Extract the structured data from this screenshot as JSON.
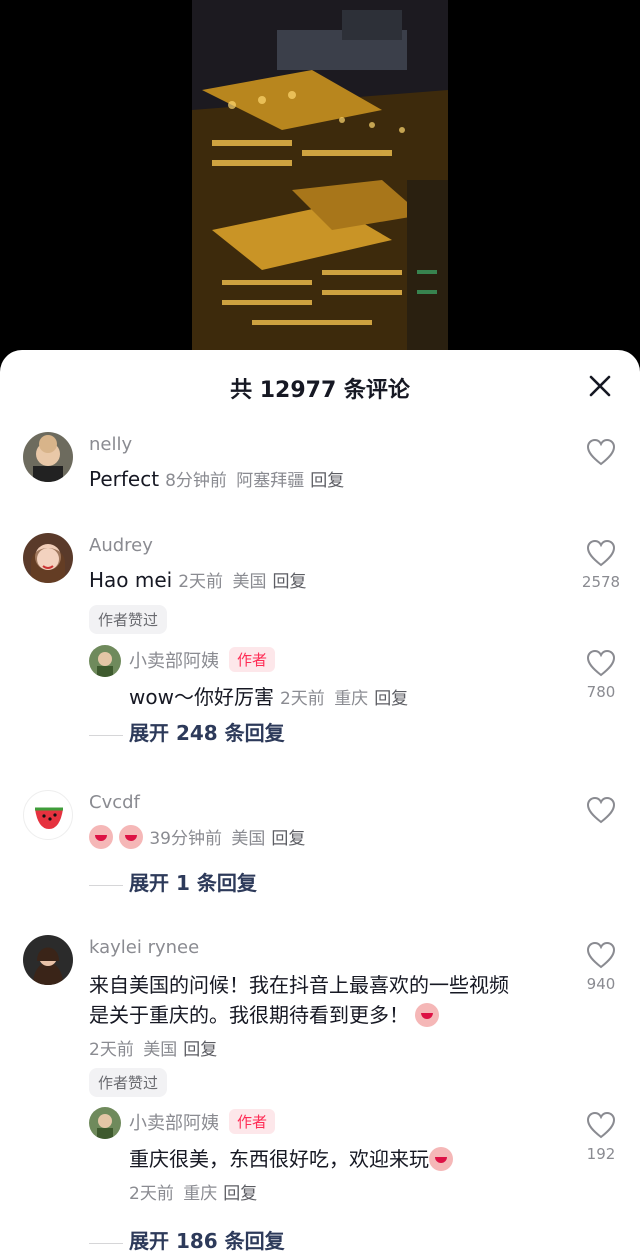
{
  "header": {
    "title": "共 12977 条评论"
  },
  "comments": [
    {
      "username": "nelly",
      "text": "Perfect",
      "time": "8分钟前",
      "location": "阿塞拜疆",
      "reply_label": "回复",
      "likes": ""
    },
    {
      "username": "Audrey",
      "text": "Hao mei",
      "time": "2天前",
      "location": "美国",
      "reply_label": "回复",
      "likes": "2578",
      "badge": "作者赞过",
      "sub": {
        "username": "小卖部阿姨",
        "author_tag": "作者",
        "text": "wow～你好厉害",
        "time": "2天前",
        "location": "重庆",
        "reply_label": "回复",
        "likes": "780"
      },
      "expand": "展开 248 条回复"
    },
    {
      "username": "Cvcdf",
      "text": "",
      "time": "39分钟前",
      "location": "美国",
      "reply_label": "回复",
      "likes": "",
      "expand": "展开 1 条回复"
    },
    {
      "username": "kaylei rynee",
      "text_line1": "来自美国的问候！我在抖音上最喜欢的一些视频",
      "text_line2": "是关于重庆的。我很期待看到更多！",
      "time": "2天前",
      "location": "美国",
      "reply_label": "回复",
      "likes": "940",
      "badge": "作者赞过",
      "sub": {
        "username": "小卖部阿姨",
        "author_tag": "作者",
        "text": "重庆很美，东西很好吃，欢迎来玩",
        "time": "2天前",
        "location": "重庆",
        "reply_label": "回复",
        "likes": "192"
      },
      "expand": "展开 186 条回复"
    }
  ],
  "colors": {
    "accent": "#fe2c55",
    "muted": "#8a8b91",
    "text": "#161823"
  },
  "icons": {
    "close": "close-icon",
    "like": "heart-outline-icon"
  }
}
